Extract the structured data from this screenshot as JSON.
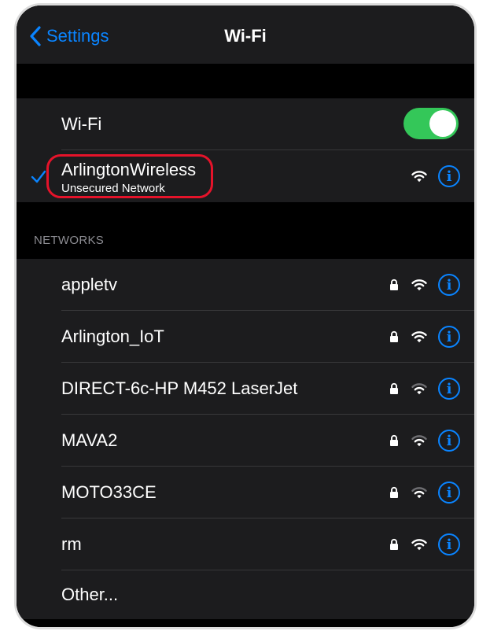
{
  "nav": {
    "back_label": "Settings",
    "title": "Wi-Fi"
  },
  "wifi_toggle": {
    "label": "Wi-Fi",
    "state": "on",
    "color": "#34c759"
  },
  "current_network": {
    "name": "ArlingtonWireless",
    "subtitle": "Unsecured Network",
    "checkmark": "checkmark-icon",
    "highlight_color": "#e5132a"
  },
  "networks_header": "NETWORKS",
  "networks": [
    {
      "name": "appletv",
      "locked": true,
      "signal": "strong"
    },
    {
      "name": "Arlington_IoT",
      "locked": true,
      "signal": "strong"
    },
    {
      "name": "DIRECT-6c-HP M452 LaserJet",
      "locked": true,
      "signal": "medium"
    },
    {
      "name": "MAVA2",
      "locked": true,
      "signal": "medium"
    },
    {
      "name": "MOTO33CE",
      "locked": true,
      "signal": "medium"
    },
    {
      "name": "rm",
      "locked": true,
      "signal": "strong"
    }
  ],
  "other_label": "Other...",
  "icons": {
    "info": "i"
  },
  "colors": {
    "accent": "#0a84ff",
    "background": "#000000",
    "cell": "#1c1c1e"
  }
}
